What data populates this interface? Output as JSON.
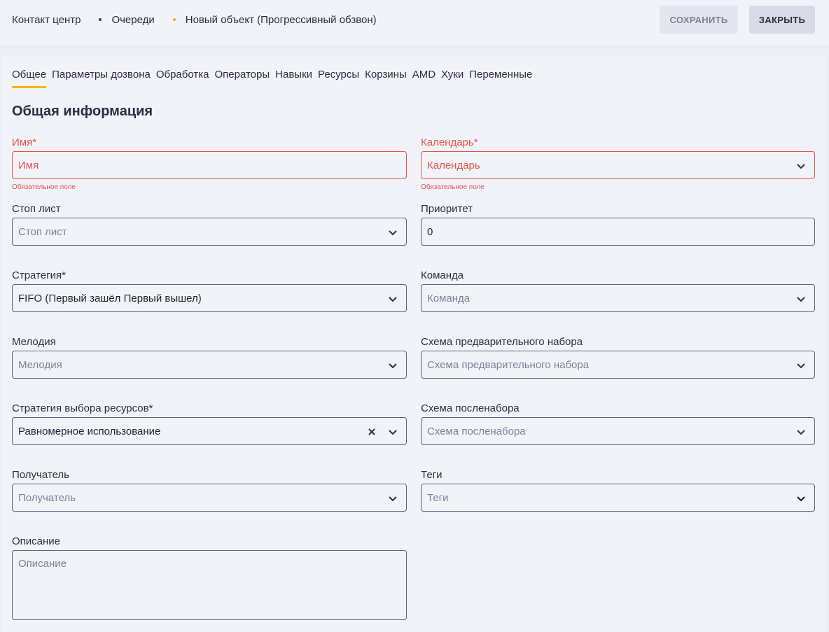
{
  "header": {
    "breadcrumb": [
      "Контакт центр",
      "Очереди",
      "Новый объект (Прогрессивный обзвон)"
    ],
    "save_label": "СОХРАНИТЬ",
    "close_label": "ЗАКРЫТЬ"
  },
  "tabs": [
    "Общее",
    "Параметры дозвона",
    "Обработка",
    "Операторы",
    "Навыки",
    "Ресурсы",
    "Корзины",
    "AMD",
    "Хуки",
    "Переменные"
  ],
  "section_title": "Общая информация",
  "required_hint": "Обязательное поле",
  "fields": {
    "name": {
      "label": "Имя*",
      "placeholder": "Имя"
    },
    "calendar": {
      "label": "Календарь*",
      "placeholder": "Календарь"
    },
    "stoplist": {
      "label": "Стоп лист",
      "placeholder": "Стоп лист"
    },
    "priority": {
      "label": "Приоритет",
      "value": "0"
    },
    "strategy": {
      "label": "Стратегия*",
      "value": "FIFO (Первый зашёл Первый вышел)"
    },
    "team": {
      "label": "Команда",
      "placeholder": "Команда"
    },
    "melody": {
      "label": "Мелодия",
      "placeholder": "Мелодия"
    },
    "predial": {
      "label": "Схема предварительного набора",
      "placeholder": "Схема предварительного набора"
    },
    "resource_strategy": {
      "label": "Стратегия выбора ресурсов*",
      "value": "Равномерное использование"
    },
    "postdial": {
      "label": "Схема посленабора",
      "placeholder": "Схема посленабора"
    },
    "recipient": {
      "label": "Получатель",
      "placeholder": "Получатель"
    },
    "tags": {
      "label": "Теги",
      "placeholder": "Теги"
    },
    "description": {
      "label": "Описание",
      "placeholder": "Описание"
    }
  },
  "colors": {
    "accent": "#f5b400",
    "error": "#e5534b",
    "text": "#2b2d42"
  }
}
